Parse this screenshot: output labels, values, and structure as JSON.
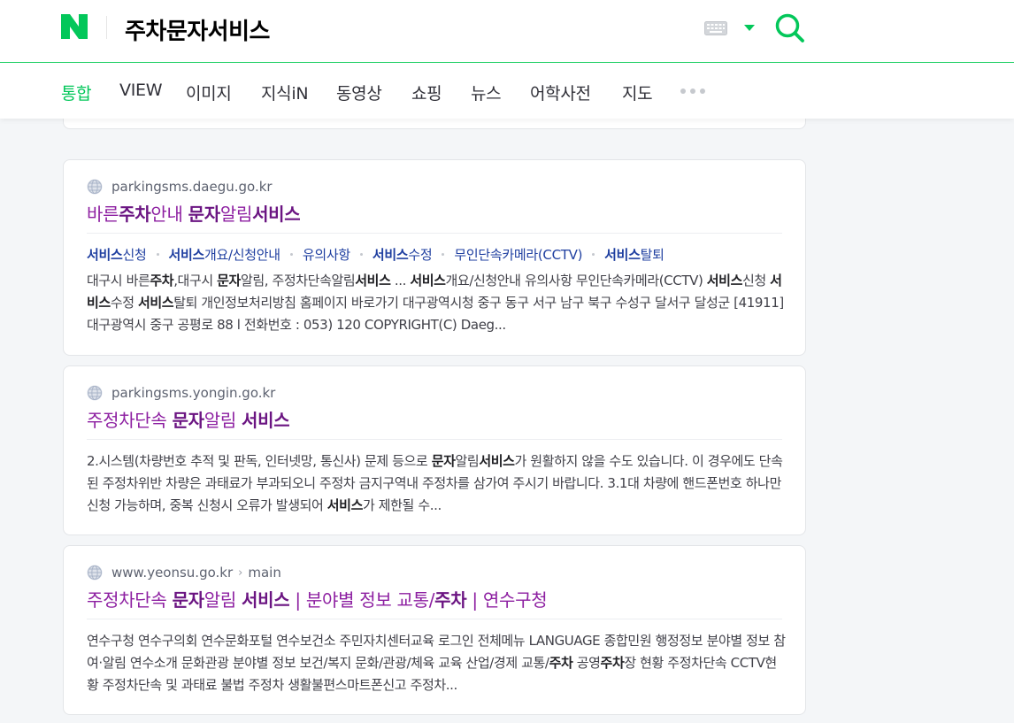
{
  "header": {
    "query": "주차문자서비스",
    "logo_letter": "N",
    "brand_color": "#03c75a",
    "icons": [
      "keyboard-icon",
      "chevron-down-icon",
      "search-icon",
      "more-icon"
    ]
  },
  "tabs": [
    {
      "label": "통합",
      "active": true
    },
    {
      "label": "VIEW"
    },
    {
      "label": "이미지"
    },
    {
      "label": "지식iN"
    },
    {
      "label": "동영상"
    },
    {
      "label": "쇼핑"
    },
    {
      "label": "뉴스"
    },
    {
      "label": "어학사전"
    },
    {
      "label": "지도"
    }
  ],
  "results": [
    {
      "source": "parkingsms.daegu.go.kr",
      "title_parts": [
        [
          "바른",
          false
        ],
        [
          "주차",
          true
        ],
        [
          "안내 ",
          false
        ],
        [
          "문자",
          true
        ],
        [
          "알림",
          false
        ],
        [
          "서비스",
          true
        ]
      ],
      "sublinks": [
        [
          [
            "서비스",
            true
          ],
          [
            "신청",
            false
          ]
        ],
        [
          [
            "서비스",
            true
          ],
          [
            "개요/신청안내",
            false
          ]
        ],
        [
          [
            "유의사항",
            false
          ]
        ],
        [
          [
            "서비스",
            true
          ],
          [
            "수정",
            false
          ]
        ],
        [
          [
            "무인단속카메라(CCTV)",
            false
          ]
        ],
        [
          [
            "서비스",
            true
          ],
          [
            "탈퇴",
            false
          ]
        ]
      ],
      "desc_parts": [
        [
          "대구시 바른",
          false
        ],
        [
          "주차",
          true
        ],
        [
          ",대구시 ",
          false
        ],
        [
          "문자",
          true
        ],
        [
          "알림, 주정차단속알림",
          false
        ],
        [
          "서비스",
          true
        ],
        [
          " ... ",
          false
        ],
        [
          "서비스",
          true
        ],
        [
          "개요/신청안내 유의사항 무인단속카메라(CCTV) ",
          false
        ],
        [
          "서비스",
          true
        ],
        [
          "신청 ",
          false
        ],
        [
          "서비스",
          true
        ],
        [
          "수정 ",
          false
        ],
        [
          "서비스",
          true
        ],
        [
          "탈퇴 개인정보처리방침 홈페이지 바로가기 대구광역시청 중구 동구 서구 남구 북구 수성구 달서구 달성군 [41911] 대구광역시 중구 공평로 88 l 전화번호 : 053) 120 COPYRIGHT(C) Daeg...",
          false
        ]
      ]
    },
    {
      "source": "parkingsms.yongin.go.kr",
      "title_parts": [
        [
          "주정차단속 ",
          false
        ],
        [
          "문자",
          true
        ],
        [
          "알림 ",
          false
        ],
        [
          "서비스",
          true
        ]
      ],
      "desc_parts": [
        [
          "2.시스템(차량번호 추적 및 판독, 인터넷망, 통신사) 문제 등으로 ",
          false
        ],
        [
          "문자",
          true
        ],
        [
          "알림",
          false
        ],
        [
          "서비스",
          true
        ],
        [
          "가 원활하지 않을 수도 있습니다. 이 경우에도 단속된 주정차위반 차량은 과태료가 부과되오니 주정차 금지구역내 주정차를 삼가여 주시기 바랍니다. 3.1대 차량에 핸드폰번호 하나만 신청 가능하며, 중복 신청시 오류가 발생되어 ",
          false
        ],
        [
          "서비스",
          true
        ],
        [
          "가 제한될 수...",
          false
        ]
      ]
    },
    {
      "source": "www.yeonsu.go.kr",
      "breadcrumb": "main",
      "title_parts": [
        [
          "주정차단속 ",
          false
        ],
        [
          "문자",
          true
        ],
        [
          "알림 ",
          false
        ],
        [
          "서비스",
          true
        ],
        [
          " | 분야별 정보 교통/",
          false
        ],
        [
          "주차",
          true
        ],
        [
          " | 연수구청",
          false
        ]
      ],
      "desc_parts": [
        [
          "연수구청 연수구의회 연수문화포털 연수보건소 주민자치센터교육 로그인 전체메뉴 LANGUAGE 종합민원 행정정보 분야별 정보 참여·알림 연수소개 문화관광 분야별 정보 보건/복지 문화/관광/체육 교육 산업/경제 교통/",
          false
        ],
        [
          "주차",
          true
        ],
        [
          " 공영",
          false
        ],
        [
          "주차",
          true
        ],
        [
          "장 현황 주정차단속 CCTV현황 주정차단속 및 과태료 불법 주정차 생활불편스마트폰신고 주정차...",
          false
        ]
      ]
    }
  ]
}
